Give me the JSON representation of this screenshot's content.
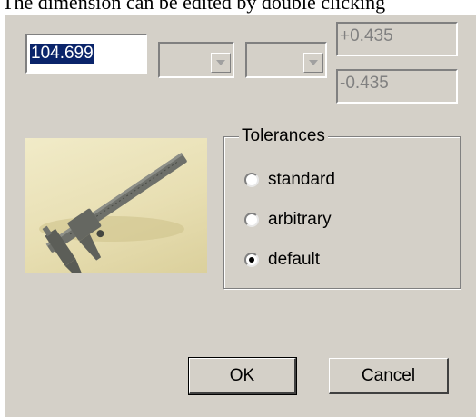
{
  "caption": "The dimension can be edited by double clicking",
  "dimension": {
    "value": "104.699",
    "unit_combo_value": "",
    "type_combo_value": ""
  },
  "tolerance_fields": {
    "upper": "+0.435",
    "lower": "-0.435"
  },
  "image": {
    "subject": "caliper-photo"
  },
  "tolerances_group": {
    "label": "Tolerances",
    "options": [
      {
        "label": "standard",
        "selected": false
      },
      {
        "label": "arbitrary",
        "selected": false
      },
      {
        "label": "default",
        "selected": true
      }
    ]
  },
  "buttons": {
    "ok": "OK",
    "cancel": "Cancel"
  },
  "colors": {
    "dialog_bg": "#d4d0c8",
    "selection_bg": "#0a246a",
    "disabled_text": "#808080"
  }
}
